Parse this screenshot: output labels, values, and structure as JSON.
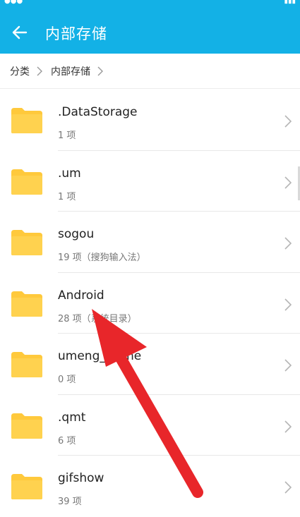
{
  "header": {
    "title": "内部存储",
    "back_icon": "back-arrow-icon",
    "background": "#13b1e6"
  },
  "breadcrumb": {
    "items": [
      "分类",
      "内部存储"
    ]
  },
  "folders": [
    {
      "name": ".DataStorage",
      "meta": "1 项"
    },
    {
      "name": ".um",
      "meta": "1 项"
    },
    {
      "name": "sogou",
      "meta": "19 项（搜狗输入法）"
    },
    {
      "name": "Android",
      "meta": "28 项（系统目录）"
    },
    {
      "name": "umeng_cache",
      "meta": "0 项"
    },
    {
      "name": ".qmt",
      "meta": "6 项"
    },
    {
      "name": "gifshow",
      "meta": "39 项"
    }
  ],
  "colors": {
    "folder": "#ffc93c",
    "annotation_arrow": "#e8262a"
  }
}
